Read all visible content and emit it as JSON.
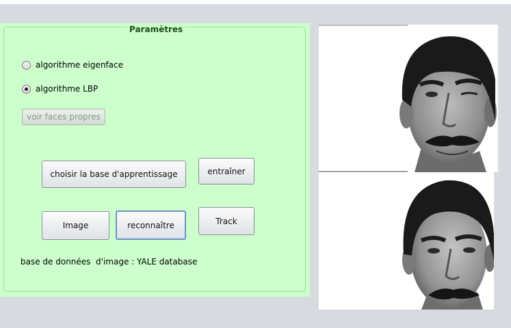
{
  "parameters_panel": {
    "title": "Paramètres",
    "radio_eigenface": {
      "label": "algorithme eigenface",
      "selected": false
    },
    "radio_lbp": {
      "label": "algorithme LBP",
      "selected": true
    },
    "voir_faces_propres": "voir faces propres",
    "choisir_base": "choisir la base d'apprentissage",
    "entrainer": "entraîner",
    "image": "Image",
    "reconnaitre": "reconnaître",
    "track": "Track",
    "database_info": "base de données  d'image : YALE database"
  },
  "images": {
    "top": {
      "kind": "grayscale face photo, smiling with mustache"
    },
    "bottom": {
      "kind": "grayscale face photo, neutral with mustache"
    }
  },
  "colors": {
    "panel_bg": "#ccffcc",
    "window_bg": "#d7dbe0"
  }
}
